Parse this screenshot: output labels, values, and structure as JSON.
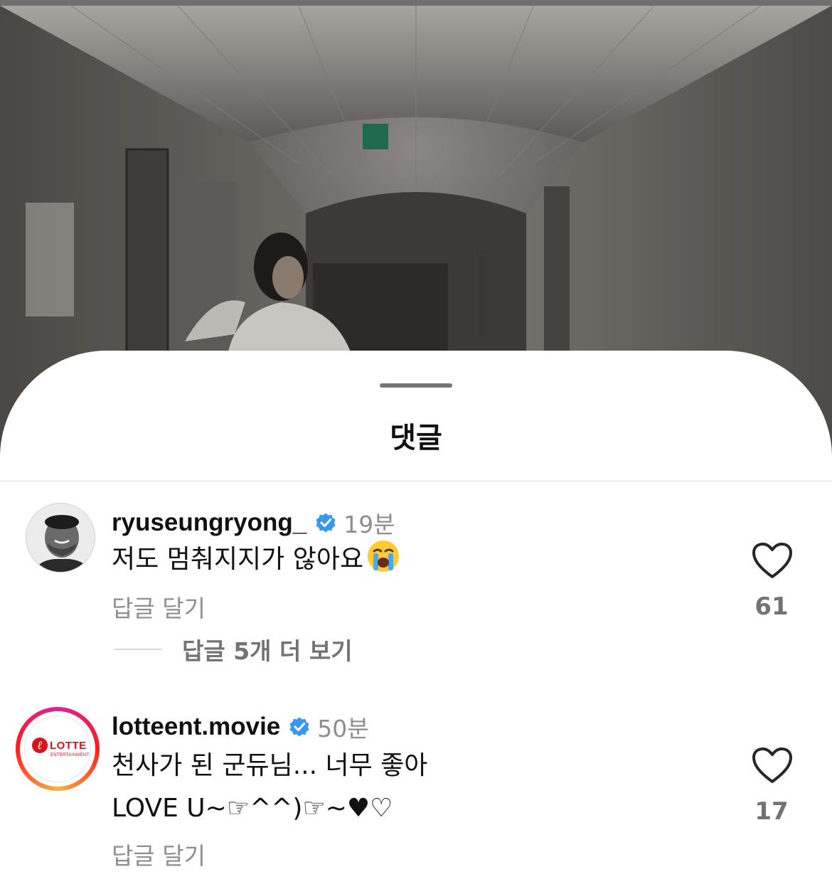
{
  "sheet": {
    "title": "댓글"
  },
  "comments": [
    {
      "username": "ryuseungryong_",
      "time": "19분",
      "text": "저도 멈춰지지가 않아요",
      "emoji_icon": "loudly-crying-face-icon",
      "reply_label": "답글 달기",
      "more_replies_label": "답글 5개 더 보기",
      "likes": "61"
    },
    {
      "username": "lotteent.movie",
      "time": "50분",
      "text_line1": "천사가 된 군듀님... 너무 좋아",
      "text_line2": "LOVE U~☞^^)☞~♥♡",
      "reply_label": "답글 달기",
      "likes": "17",
      "avatar_logo": {
        "brand": "LOTTE",
        "sub": "ENTERTAINMENT"
      }
    }
  ],
  "colors": {
    "verified_blue": "#3897f0",
    "muted_text": "#8e8e8e",
    "brand_red": "#d8121b"
  }
}
